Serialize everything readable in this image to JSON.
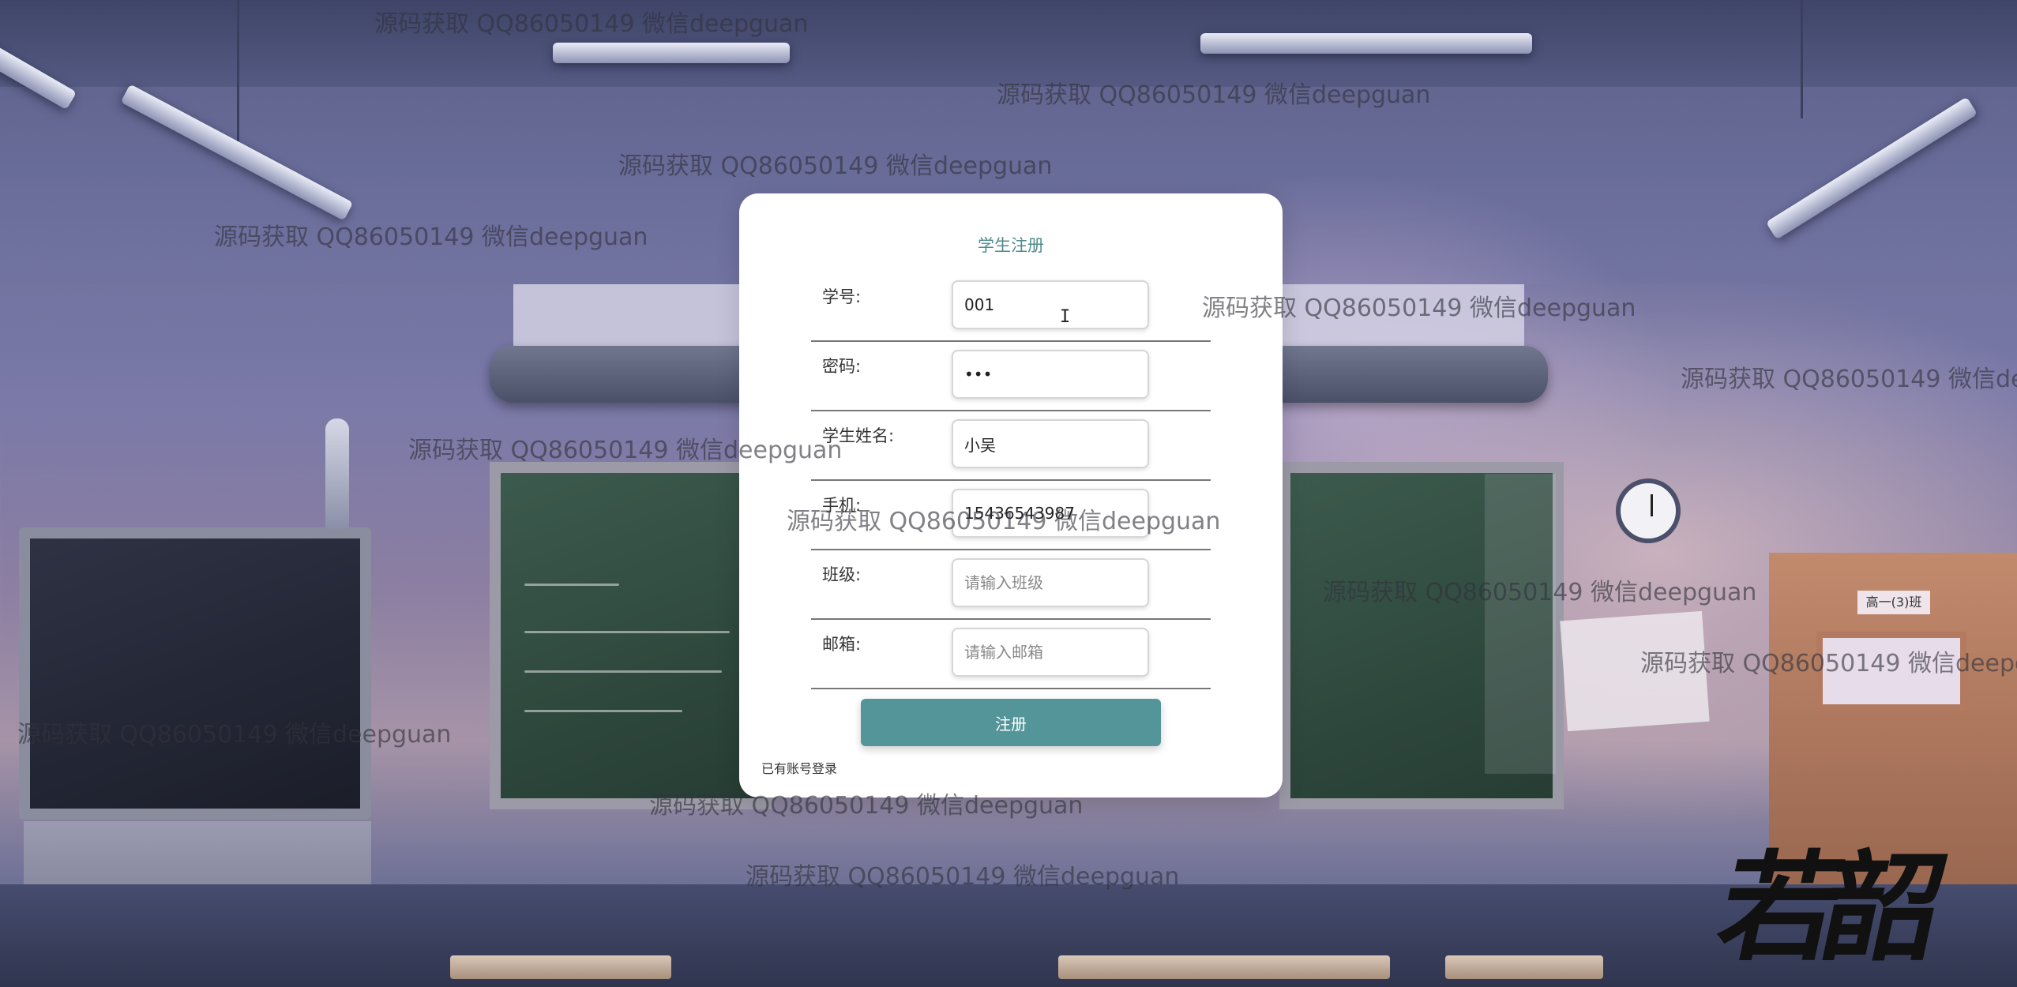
{
  "form": {
    "title": "学生注册",
    "fields": [
      {
        "label": "学号:",
        "value": "001",
        "placeholder": ""
      },
      {
        "label": "密码:",
        "value": "•••",
        "placeholder": ""
      },
      {
        "label": "学生姓名:",
        "value": "小吴",
        "placeholder": ""
      },
      {
        "label": "手机:",
        "value": "15436543987",
        "placeholder": ""
      },
      {
        "label": "班级:",
        "value": "",
        "placeholder": "请输入班级"
      },
      {
        "label": "邮箱:",
        "value": "",
        "placeholder": "请输入邮箱"
      }
    ],
    "submit_label": "注册",
    "login_link": "已有账号登录"
  },
  "cursor_glyph": "I",
  "background": {
    "calligraphy": "若韶",
    "door_sign": "高一(3)班"
  },
  "watermark_text": "源码获取 QQ86050149 微信deepguan",
  "colors": {
    "accent": "#539598",
    "title": "#4f8b8d"
  }
}
